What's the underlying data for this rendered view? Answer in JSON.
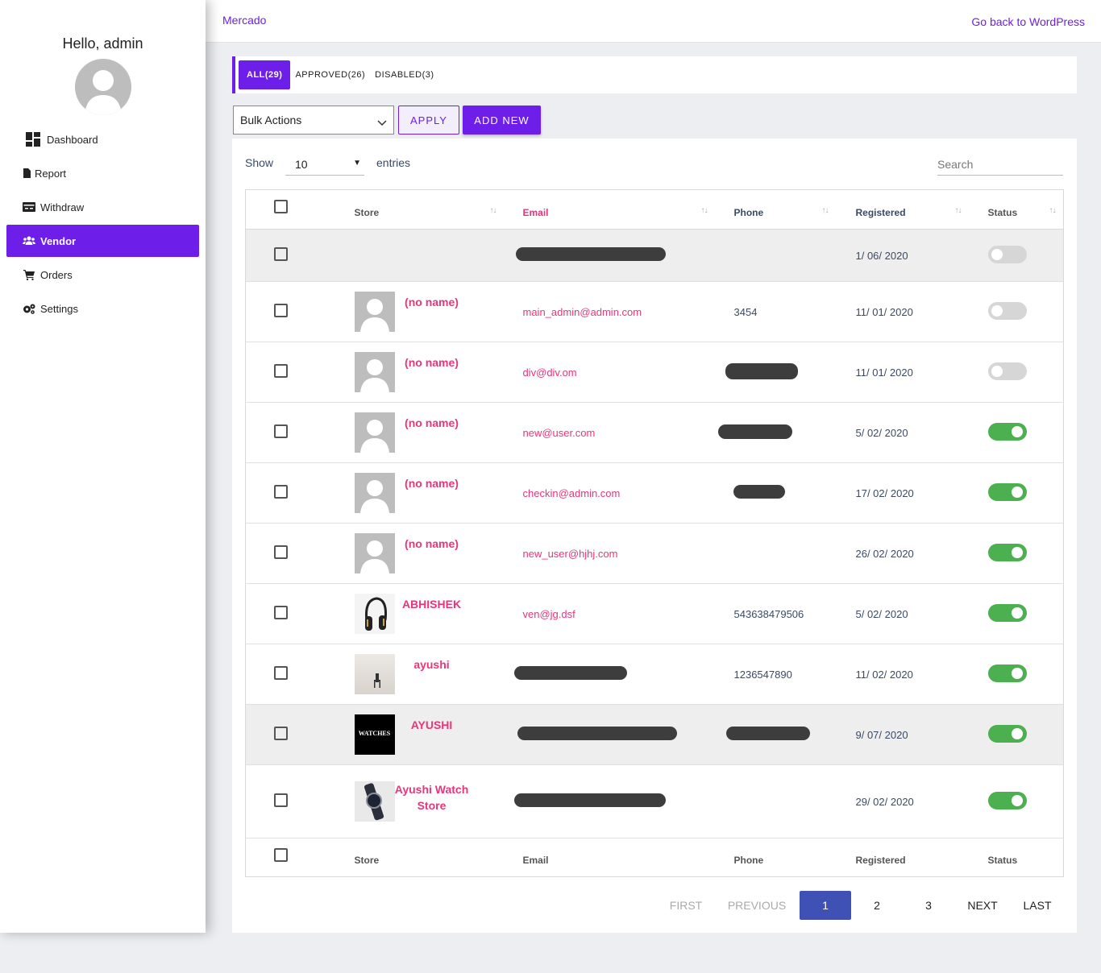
{
  "sidebar": {
    "greeting": "Hello, admin",
    "items": [
      {
        "label": "Dashboard",
        "icon": "dashboard-icon"
      },
      {
        "label": "Report",
        "icon": "file-icon"
      },
      {
        "label": "Withdraw",
        "icon": "money-icon"
      },
      {
        "label": "Vendor",
        "icon": "users-icon",
        "active": true
      },
      {
        "label": "Orders",
        "icon": "cart-icon"
      },
      {
        "label": "Settings",
        "icon": "gears-icon"
      }
    ]
  },
  "header": {
    "brand": "Mercado",
    "back_link": "Go back to WordPress"
  },
  "tabs": [
    {
      "label": "ALL(29)",
      "active": true
    },
    {
      "label": "APPROVED(26)"
    },
    {
      "label": "DISABLED(3)"
    }
  ],
  "actions": {
    "bulk_select": "Bulk Actions",
    "apply": "APPLY",
    "add_new": "ADD NEW"
  },
  "table_controls": {
    "show_label": "Show",
    "entries_value": "10",
    "entries_label": "entries",
    "search_placeholder": "Search"
  },
  "columns": [
    "Store",
    "Email",
    "Phone",
    "Registered",
    "Status"
  ],
  "rows": [
    {
      "name": "",
      "email": "",
      "phone": "",
      "registered": "1/ 06/ 2020",
      "status": false,
      "thumb": "none"
    },
    {
      "name": "(no name)",
      "email": "main_admin@admin.com",
      "phone": "3454",
      "registered": "11/ 01/ 2020",
      "status": false,
      "thumb": "placeholder"
    },
    {
      "name": "(no name)",
      "email": "div@div.om",
      "phone": "",
      "registered": "11/ 01/ 2020",
      "status": false,
      "thumb": "placeholder"
    },
    {
      "name": "(no name)",
      "email": "new@user.com",
      "phone": "",
      "registered": "5/ 02/ 2020",
      "status": true,
      "thumb": "placeholder"
    },
    {
      "name": "(no name)",
      "email": "checkin@admin.com",
      "phone": "",
      "registered": "17/ 02/ 2020",
      "status": true,
      "thumb": "placeholder"
    },
    {
      "name": "(no name)",
      "email": "new_user@hjhj.com",
      "phone": "",
      "registered": "26/ 02/ 2020",
      "status": true,
      "thumb": "placeholder"
    },
    {
      "name": "ABHISHEK",
      "email": "ven@jg.dsf",
      "phone": "543638479506",
      "registered": "5/ 02/ 2020",
      "status": true,
      "thumb": "headphones"
    },
    {
      "name": "ayushi",
      "email": "",
      "phone": "1236547890",
      "registered": "11/ 02/ 2020",
      "status": true,
      "thumb": "chair"
    },
    {
      "name": "AYUSHI",
      "email": "",
      "phone": "",
      "registered": "9/ 07/ 2020",
      "status": true,
      "thumb": "watches",
      "thumb_text": "WATCHES"
    },
    {
      "name": "Ayushi Watch Store",
      "email": "",
      "phone": "",
      "registered": "29/ 02/ 2020",
      "status": true,
      "thumb": "watch"
    }
  ],
  "pagination": {
    "first": "FIRST",
    "previous": "PREVIOUS",
    "pages": [
      "1",
      "2",
      "3"
    ],
    "current": "1",
    "next": "NEXT",
    "last": "LAST"
  },
  "colors": {
    "accent": "#6d1ee8",
    "link_pink": "#e8367a",
    "toggle_on": "#4caf50",
    "page_current": "#3f51b5"
  }
}
